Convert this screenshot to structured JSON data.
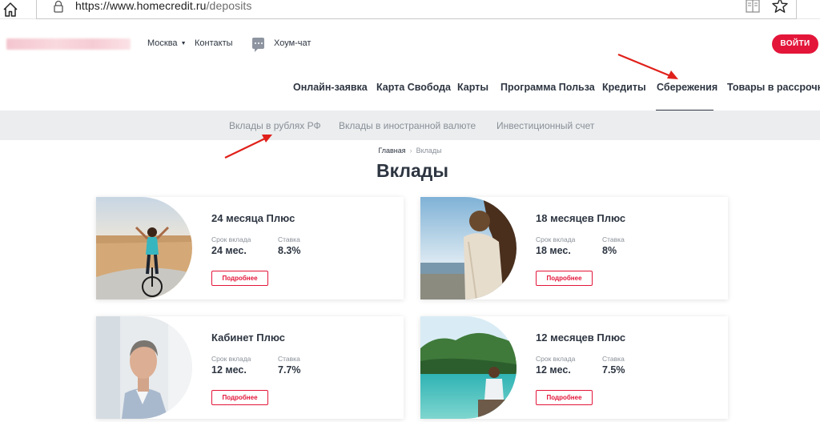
{
  "browser": {
    "url_host": "https://www.homecredit.ru",
    "url_path": "/deposits"
  },
  "header": {
    "city": "Москва",
    "contacts": "Контакты",
    "chat": "Хоум-чат",
    "login": "ВОЙТИ"
  },
  "nav": {
    "items": [
      "Онлайн-заявка",
      "Карта Свобода",
      "Карты",
      "Программа Польза",
      "Кредиты",
      "Сбережения",
      "Товары в рассрочку"
    ],
    "active": "Сбережения"
  },
  "subnav": {
    "items": [
      "Вклады в рублях РФ",
      "Вклады в иностранной валюте",
      "Инвестиционный счет"
    ]
  },
  "breadcrumb": {
    "home": "Главная",
    "current": "Вклады"
  },
  "page_title": "Вклады",
  "cards": [
    {
      "title": "24 месяца Плюс",
      "term_label": "Срок вклада",
      "term": "24 мес.",
      "rate_label": "Ставка",
      "rate": "8.3%",
      "button": "Подробнее"
    },
    {
      "title": "18 месяцев Плюс",
      "term_label": "Срок вклада",
      "term": "18 мес.",
      "rate_label": "Ставка",
      "rate": "8%",
      "button": "Подробнее"
    },
    {
      "title": "Кабинет Плюс",
      "term_label": "Срок вклада",
      "term": "12 мес.",
      "rate_label": "Ставка",
      "rate": "7.7%",
      "button": "Подробнее"
    },
    {
      "title": "12 месяцев Плюс",
      "term_label": "Срок вклада",
      "term": "12 мес.",
      "rate_label": "Ставка",
      "rate": "7.5%",
      "button": "Подробнее"
    }
  ],
  "colors": {
    "brand_red": "#e3163a",
    "text_dark": "#2d3541",
    "muted": "#8a9099",
    "subnav_bg": "#ebedee",
    "annotation_arrow": "#e0201a"
  }
}
